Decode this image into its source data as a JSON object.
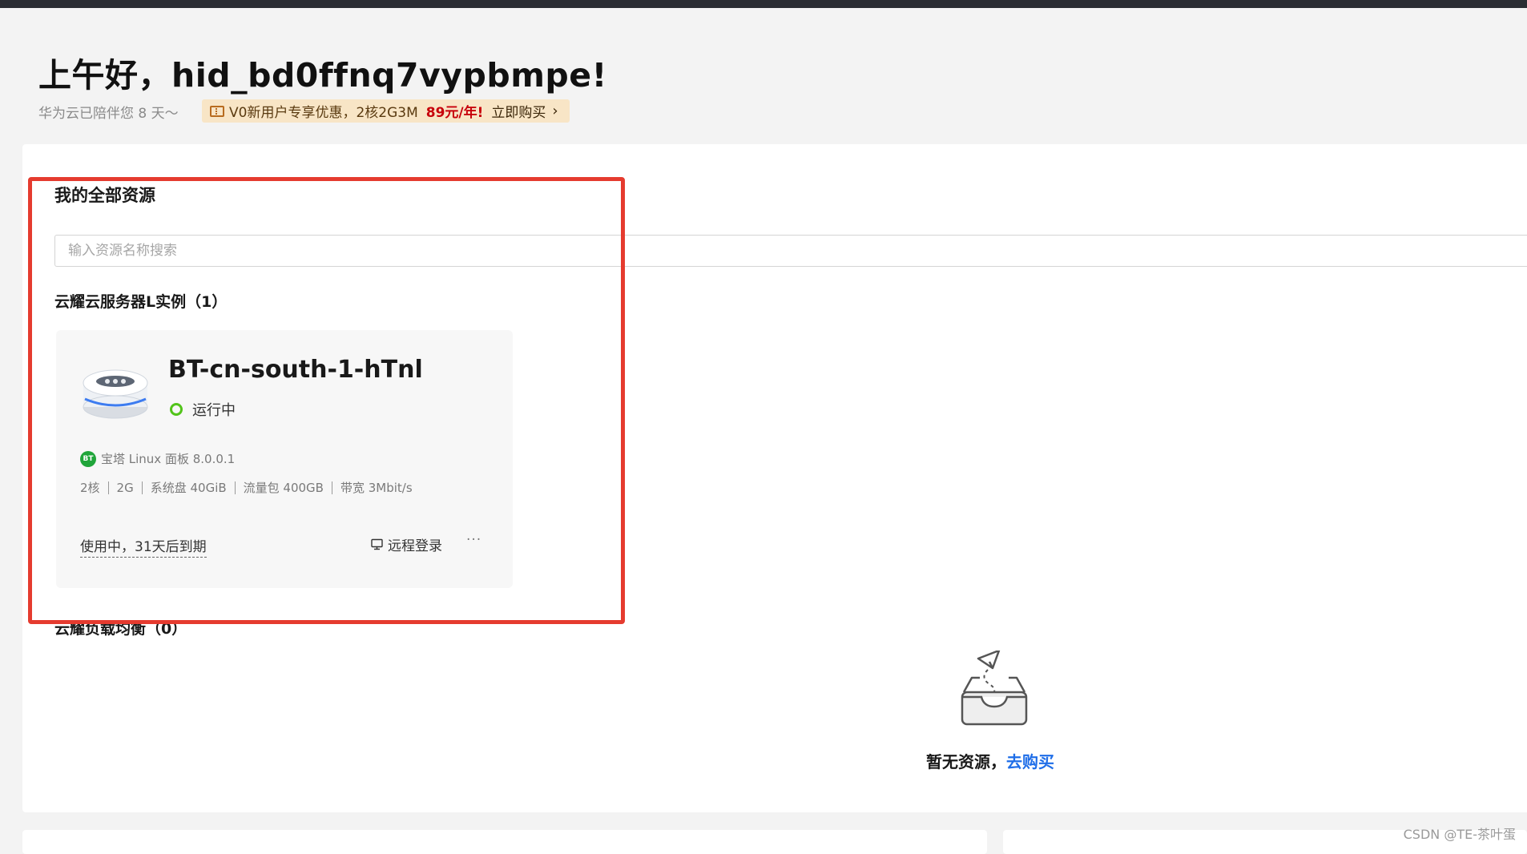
{
  "header": {
    "greeting": "上午好，hid_bd0ffnq7vypbmpe!",
    "companion_text": "华为云已陪伴您 8 天～",
    "promo": {
      "text": "V0新用户专享优惠，2核2G3M",
      "price": "89元/年!",
      "buy_label": "立即购买",
      "chevron": "›",
      "icon": "ticket-icon"
    }
  },
  "resources": {
    "title": "我的全部资源",
    "search_placeholder": "输入资源名称搜索",
    "groups": [
      {
        "title": "云耀云服务器L实例（1）",
        "instances": [
          {
            "name": "BT-cn-south-1-hTnl",
            "status": "运行中",
            "image_badge": "BT",
            "image": "宝塔 Linux 面板 8.0.0.1",
            "specs": [
              "2核",
              "2G",
              "系统盘 40GiB",
              "流量包 400GB",
              "带宽 3Mbit/s"
            ],
            "expiry": "使用中，31天后到期",
            "remote_login": "远程登录",
            "more": "···"
          }
        ]
      },
      {
        "title": "云耀负载均衡（0）",
        "empty_text": "暂无资源，",
        "buy_link": "去购买"
      }
    ]
  },
  "watermark": "CSDN @TE-茶叶蛋",
  "colors": {
    "accent_blue": "#1f6ee8",
    "price_red": "#c7000b",
    "status_green": "#52c41a",
    "highlight_red": "#e53b2f",
    "promo_bg": "#f8e5c6"
  }
}
